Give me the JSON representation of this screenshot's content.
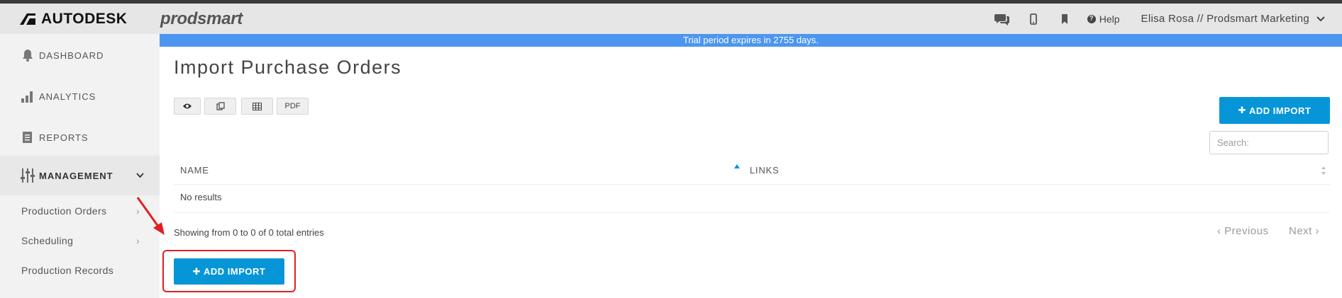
{
  "header": {
    "brand": "AUTODESK",
    "product": "prodsmart",
    "help_label": "Help",
    "user_label": "Elisa Rosa // Prodsmart Marketing"
  },
  "banner": {
    "text": "Trial period expires in 2755 days."
  },
  "sidebar": {
    "items": [
      {
        "label": "DASHBOARD"
      },
      {
        "label": "ANALYTICS"
      },
      {
        "label": "REPORTS"
      },
      {
        "label": "MANAGEMENT"
      }
    ],
    "sub_items": [
      {
        "label": "Production Orders"
      },
      {
        "label": "Scheduling"
      },
      {
        "label": "Production Records"
      }
    ]
  },
  "page": {
    "title": "Import Purchase Orders",
    "toolbar": {
      "pdf_label": "PDF"
    },
    "add_import_label": "ADD IMPORT",
    "search_placeholder": "Search:",
    "table": {
      "columns": [
        "NAME",
        "LINKS"
      ],
      "empty_text": "No results"
    },
    "showing_text": "Showing from 0 to 0 of 0 total entries",
    "pagination": {
      "previous": "Previous",
      "next": "Next"
    }
  },
  "colors": {
    "accent": "#0696d7",
    "banner": "#4c96f0",
    "highlight": "#e02020"
  }
}
